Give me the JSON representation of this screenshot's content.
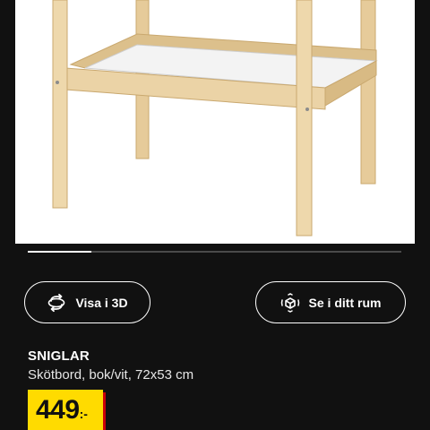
{
  "gallery": {
    "image_alt": "Skötbord",
    "progress_fraction": 0.17
  },
  "actions": {
    "view_3d_label": "Visa i 3D",
    "view_in_room_label": "Se i ditt rum"
  },
  "product": {
    "name": "SNIGLAR",
    "description": "Skötbord, bok/vit, 72x53 cm",
    "price_integer": "449",
    "price_suffix": ":-"
  },
  "colors": {
    "background": "#111111",
    "price_tag": "#ffdb00",
    "price_shadow": "#cc0008",
    "text": "#ffffff"
  },
  "icons": {
    "view_3d": "rotate-3d-icon",
    "view_in_room": "ar-cube-icon"
  }
}
